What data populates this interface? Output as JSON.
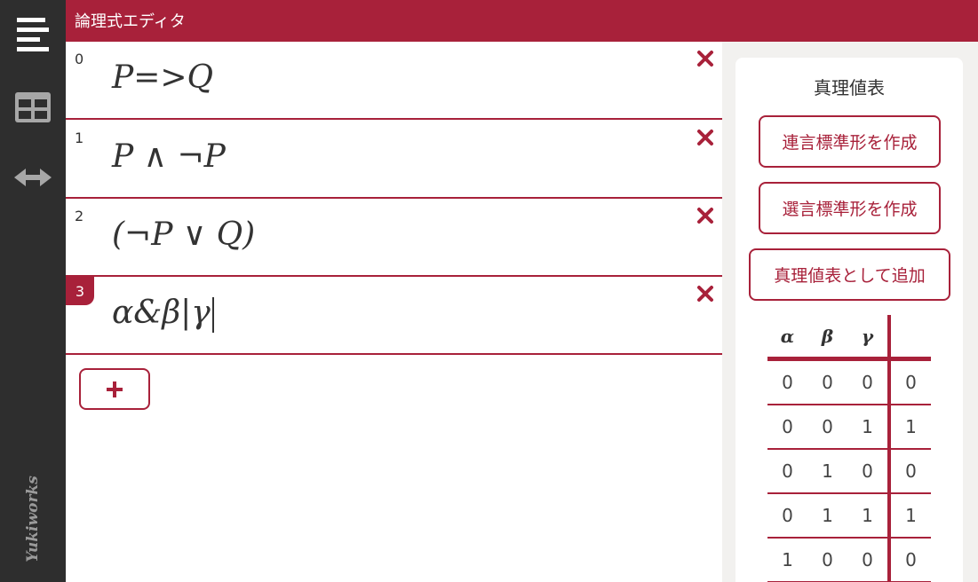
{
  "app": {
    "title": "論理式エディタ",
    "brand": "Yukiworks"
  },
  "sidebar": {
    "icons": [
      "menu-icon",
      "table-icon",
      "swap-horizontal-icon"
    ]
  },
  "formulas": [
    {
      "index": "0",
      "text": "P=>Q",
      "active": false
    },
    {
      "index": "1",
      "text": "P ∧ ¬P",
      "active": false
    },
    {
      "index": "2",
      "text": "(¬P ∨ Q)",
      "active": false
    },
    {
      "index": "3",
      "text": "α&β|γ",
      "active": true
    }
  ],
  "add_button": {
    "icon": "plus-icon"
  },
  "panel": {
    "title": "真理値表",
    "buttons": {
      "cnf": "連言標準形を作成",
      "dnf": "選言標準形を作成",
      "add_truth_table": "真理値表として追加"
    },
    "truth_table": {
      "headers": [
        "α",
        "β",
        "γ",
        ""
      ],
      "rows": [
        [
          "0",
          "0",
          "0",
          "0"
        ],
        [
          "0",
          "0",
          "1",
          "1"
        ],
        [
          "0",
          "1",
          "0",
          "0"
        ],
        [
          "0",
          "1",
          "1",
          "1"
        ],
        [
          "1",
          "0",
          "0",
          "0"
        ]
      ]
    }
  },
  "colors": {
    "accent": "#a8213a",
    "sidebar": "#2e2e2e",
    "background": "#f2f1ef"
  }
}
